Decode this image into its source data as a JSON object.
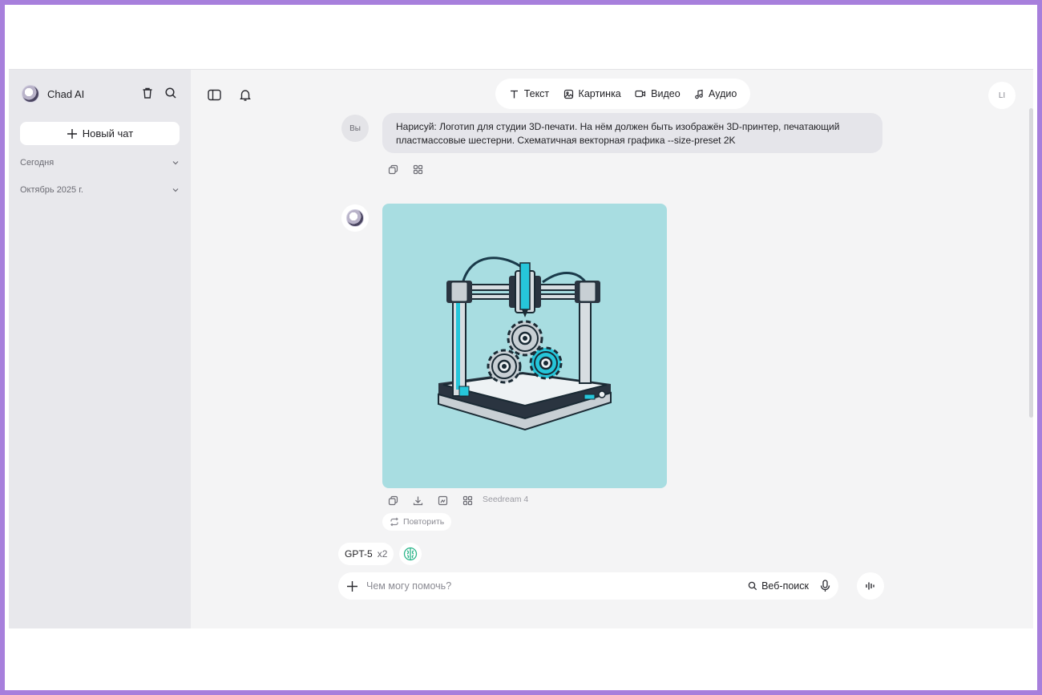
{
  "app": {
    "name": "Chad AI",
    "new_chat_label": "Новый чат",
    "groups": [
      {
        "label": "Сегодня"
      },
      {
        "label": "Октябрь 2025 г."
      }
    ]
  },
  "modes": [
    {
      "label": "Текст",
      "icon": "text-icon"
    },
    {
      "label": "Картинка",
      "icon": "image-icon"
    },
    {
      "label": "Видео",
      "icon": "video-icon"
    },
    {
      "label": "Аудио",
      "icon": "music-note-icon"
    }
  ],
  "user": {
    "initials": "LI",
    "avatar_label": "Вы"
  },
  "conversation": {
    "user_message": "Нарисуй: Логотип для студии 3D-печати. На нём должен быть изображён 3D-принтер, печатающий пластмассовые шестерни. Схематичная векторная графика --size-preset 2K",
    "generator_model": "Seedream 4",
    "retry_label": "Повторить"
  },
  "composer": {
    "model": "GPT-5",
    "multiplier": "x2",
    "placeholder": "Чем могу помочь?",
    "web_search_label": "Веб-поиск"
  },
  "colors": {
    "accent": "#a77fdc",
    "image_background": "#a8dde1",
    "printer_cyan": "#26c6da"
  }
}
